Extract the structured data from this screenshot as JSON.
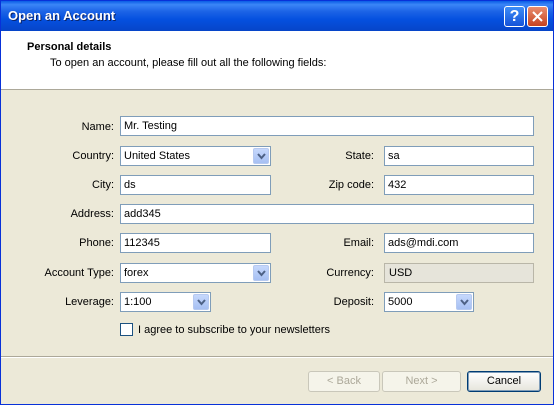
{
  "window": {
    "title": "Open an Account",
    "help_label": "?"
  },
  "header": {
    "title": "Personal details",
    "subtitle": "To open an account, please fill out all the following fields:"
  },
  "form": {
    "name": {
      "label": "Name:",
      "value": "Mr. Testing"
    },
    "country": {
      "label": "Country:",
      "value": "United States"
    },
    "state": {
      "label": "State:",
      "value": "sa"
    },
    "city": {
      "label": "City:",
      "value": "ds"
    },
    "zip": {
      "label": "Zip code:",
      "value": "432"
    },
    "address": {
      "label": "Address:",
      "value": "add345"
    },
    "phone": {
      "label": "Phone:",
      "value": "112345"
    },
    "email": {
      "label": "Email:",
      "value": "ads@mdi.com"
    },
    "account_type": {
      "label": "Account Type:",
      "value": "forex"
    },
    "currency": {
      "label": "Currency:",
      "value": "USD"
    },
    "leverage": {
      "label": "Leverage:",
      "value": "1:100"
    },
    "deposit": {
      "label": "Deposit:",
      "value": "5000"
    },
    "newsletter": {
      "label": "I agree to subscribe to your newsletters",
      "checked": false
    }
  },
  "buttons": {
    "back": "< Back",
    "next": "Next >",
    "cancel": "Cancel"
  }
}
